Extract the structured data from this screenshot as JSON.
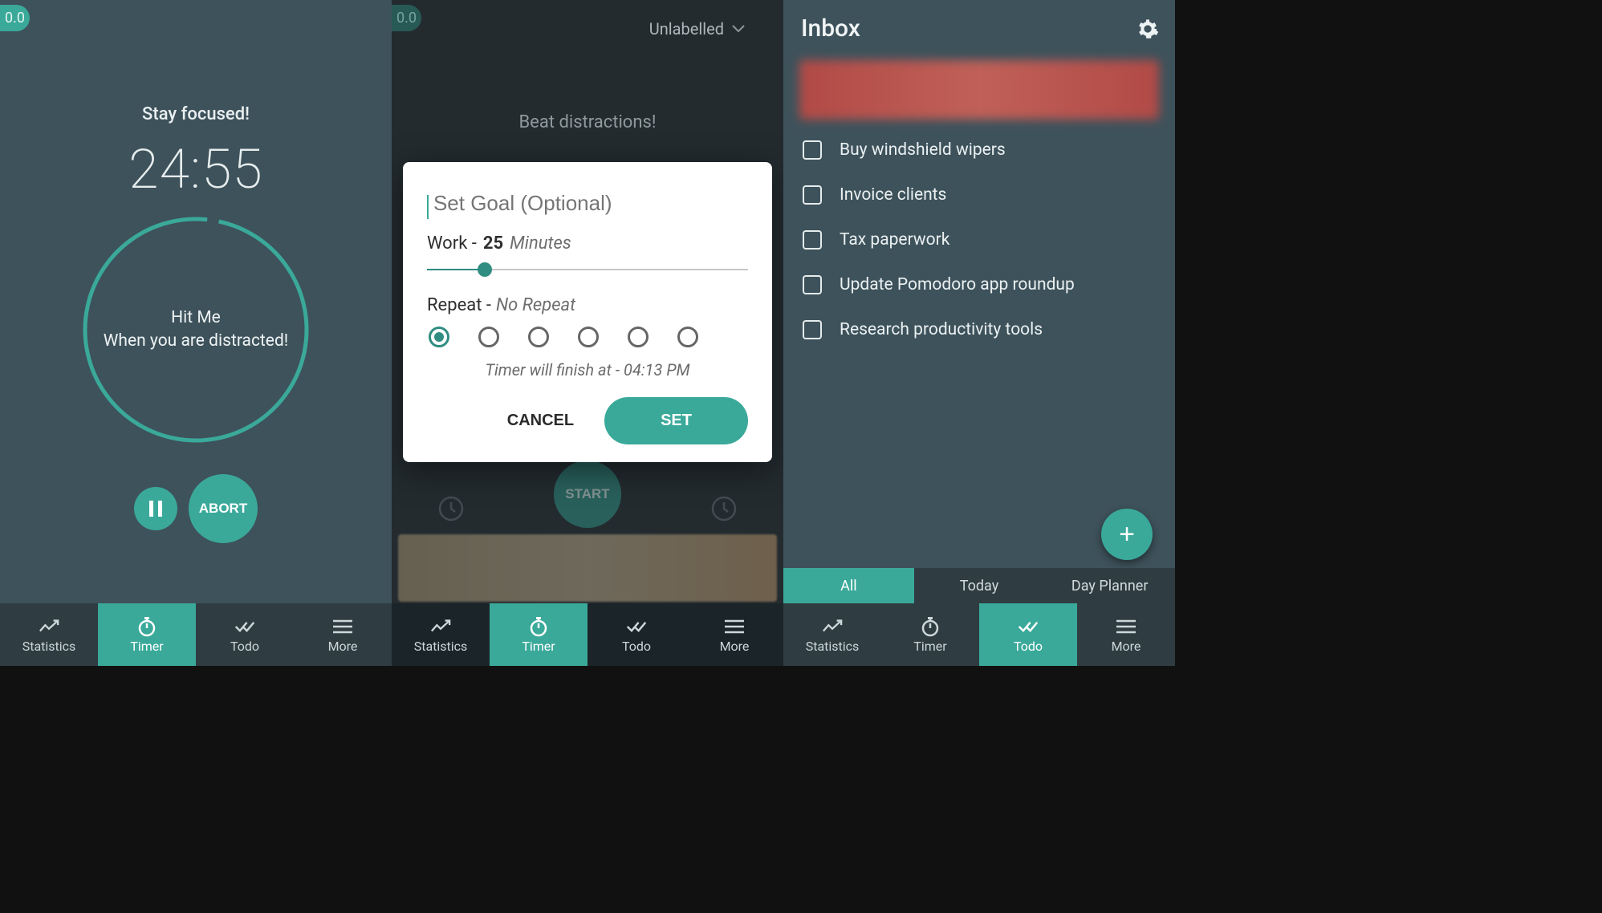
{
  "colors": {
    "accent": "#3aa99a",
    "bg": "#3e525b",
    "bgDark": "#232b2f"
  },
  "nav": {
    "items": [
      {
        "label": "Statistics",
        "icon": "chart-line-icon"
      },
      {
        "label": "Timer",
        "icon": "stopwatch-icon"
      },
      {
        "label": "Todo",
        "icon": "checkmarks-icon"
      },
      {
        "label": "More",
        "icon": "menu-icon"
      }
    ]
  },
  "screen1": {
    "pill": "0.0",
    "headline": "Stay focused!",
    "time": "24:55",
    "ringLine1": "Hit Me",
    "ringLine2": "When you are distracted!",
    "abort": "ABORT",
    "navActiveIndex": 1
  },
  "screen2": {
    "pill": "0.0",
    "labelDropdown": "Unlabelled",
    "headline": "Beat distractions!",
    "start": "START",
    "navActiveIndex": 1,
    "modal": {
      "goalPlaceholder": "Set Goal (Optional)",
      "workLabel": "Work -",
      "workValue": "25",
      "workUnit": "Minutes",
      "repeatLabel": "Repeat -",
      "repeatValue": "No Repeat",
      "repeatCount": 6,
      "repeatSelectedIndex": 0,
      "finishAt": "Timer will finish at - 04:13 PM",
      "cancel": "CANCEL",
      "set": "SET"
    }
  },
  "screen3": {
    "title": "Inbox",
    "items": [
      "Buy windshield wipers",
      "Invoice clients",
      "Tax paperwork",
      "Update Pomodoro app roundup",
      "Research productivity tools"
    ],
    "tabs": [
      "All",
      "Today",
      "Day Planner"
    ],
    "tabsActiveIndex": 0,
    "navActiveIndex": 2
  }
}
